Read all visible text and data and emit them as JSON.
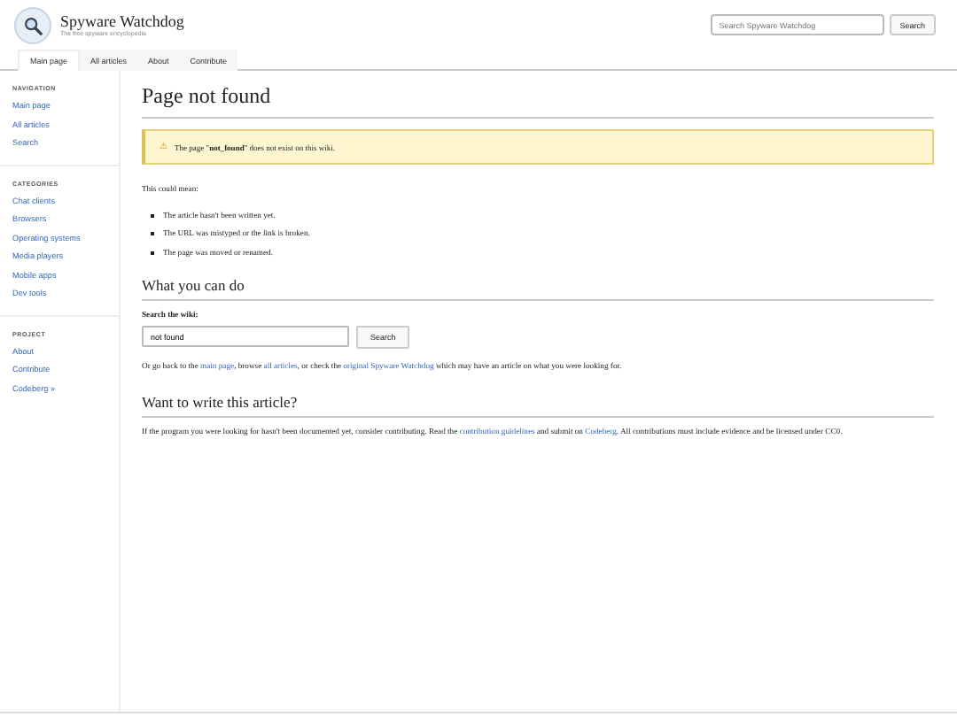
{
  "site": {
    "title": "Spyware Watchdog",
    "tagline": "The free spyware encyclopedia"
  },
  "search": {
    "placeholder": "Search Spyware Watchdog",
    "button": "Search"
  },
  "tabs": [
    {
      "label": "Main page",
      "selected": true
    },
    {
      "label": "All articles",
      "selected": false
    },
    {
      "label": "About",
      "selected": false
    },
    {
      "label": "Contribute",
      "selected": false
    }
  ],
  "sidebar": [
    {
      "heading": "NAVIGATION",
      "items": [
        "Main page",
        "All articles",
        "Search"
      ]
    },
    {
      "heading": "CATEGORIES",
      "items": [
        "Chat clients",
        "Browsers",
        "Operating systems",
        "Media players",
        "Mobile apps",
        "Dev tools"
      ]
    },
    {
      "heading": "PROJECT",
      "items": [
        "About",
        "Contribute",
        "Codeberg »"
      ]
    }
  ],
  "content": {
    "title": "Page not found",
    "notice": {
      "icon": "⚠",
      "text": "The page \"**not_found**\" does not exist on this wiki."
    },
    "intro": "This could mean:",
    "reasons": [
      "The article hasn't been written yet.",
      "The URL was mistyped or the link is broken.",
      "The page was moved or renamed."
    ],
    "section_1": {
      "heading": "What you can do",
      "search_label": "Search the wiki:",
      "search_value": "not found",
      "search_button": "Search",
      "paragraph": [
        {
          "text": "Or go back to the ",
          "link": false
        },
        {
          "text": "main page",
          "link": true
        },
        {
          "text": ", browse ",
          "link": false
        },
        {
          "text": "all articles",
          "link": true
        },
        {
          "text": ", or check the ",
          "link": false
        },
        {
          "text": "original Spyware Watchdog",
          "link": true
        },
        {
          "text": " which may have an article on what you were looking for.",
          "link": false
        }
      ]
    },
    "section_2": {
      "heading": "Want to write this article?",
      "paragraph": [
        {
          "text": "If the program you were looking for hasn't been documented yet, consider contributing. Read the ",
          "link": false
        },
        {
          "text": "contribution guidelines",
          "link": true
        },
        {
          "text": " and submit on ",
          "link": false
        },
        {
          "text": "Codeberg",
          "link": true
        },
        {
          "text": ". All contributions must include evidence and be licensed under CC0.",
          "link": false
        }
      ]
    }
  }
}
